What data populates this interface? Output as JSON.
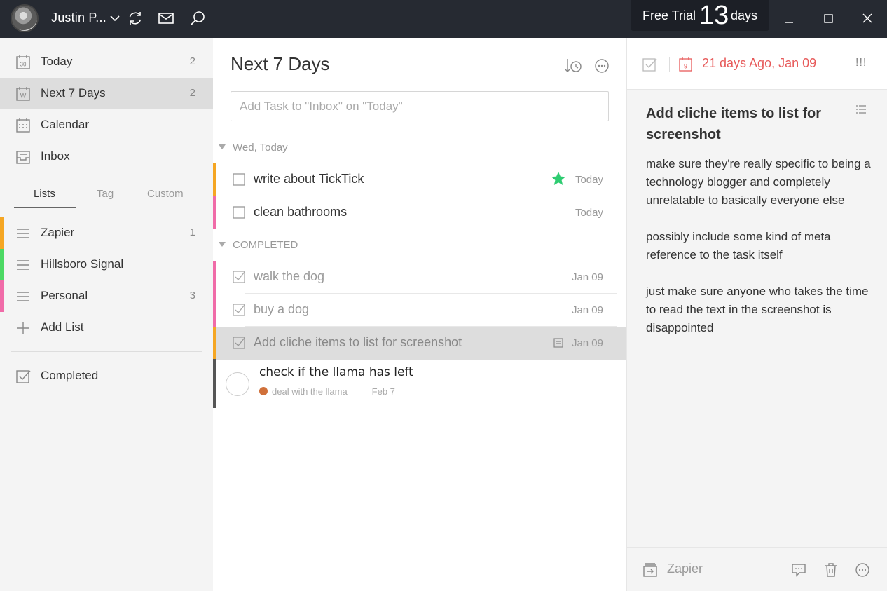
{
  "titlebar": {
    "user_name": "Justin P...",
    "trial_label": "Free Trial",
    "trial_days": "13",
    "trial_suffix": "days"
  },
  "sidebar": {
    "items": [
      {
        "label": "Today",
        "count": "2",
        "icon": "calendar-30-icon"
      },
      {
        "label": "Next 7 Days",
        "count": "2",
        "icon": "calendar-week-icon"
      },
      {
        "label": "Calendar",
        "count": "",
        "icon": "calendar-grid-icon"
      },
      {
        "label": "Inbox",
        "count": "",
        "icon": "inbox-icon"
      }
    ],
    "tabs": [
      "Lists",
      "Tag",
      "Custom"
    ],
    "lists": [
      {
        "label": "Zapier",
        "count": "1",
        "color": "#f5a623"
      },
      {
        "label": "Hillsboro Signal",
        "count": "",
        "color": "#4cd964"
      },
      {
        "label": "Personal",
        "count": "3",
        "color": "#f06ba8"
      }
    ],
    "add_list": "Add List",
    "completed": "Completed"
  },
  "main": {
    "title": "Next 7 Days",
    "add_placeholder": "Add Task to \"Inbox\" on \"Today\"",
    "section_today": "Wed, Today",
    "section_completed": "COMPLETED",
    "tasks": [
      {
        "title": "write about TickTick",
        "date": "Today",
        "color": "#f5a623",
        "starred": true
      },
      {
        "title": "clean bathrooms",
        "date": "Today",
        "color": "#f06ba8"
      }
    ],
    "completed": [
      {
        "title": "walk the dog",
        "date": "Jan 09",
        "color": "#f06ba8"
      },
      {
        "title": "buy a dog",
        "date": "Jan 09",
        "color": "#f06ba8"
      },
      {
        "title": "Add cliche items to list for screenshot",
        "date": "Jan 09",
        "color": "#f5a623"
      }
    ],
    "overlay_task": {
      "title": "check if the llama has left",
      "list": "deal with the llama",
      "date": "Feb 7"
    }
  },
  "detail": {
    "date_text": "21 days Ago, Jan 09",
    "date_day": "9",
    "priority": "!!!",
    "title": "Add cliche items to list for screenshot",
    "body": [
      "make sure they're really specific to being a technology blogger and completely unrelatable to basically everyone else",
      "possibly include some kind of meta reference to the task itself",
      "just make sure anyone who takes the time to read the text in the screenshot is disappointed"
    ],
    "list_name": "Zapier"
  },
  "colors": {
    "accent_red": "#e75a5a",
    "star_green": "#2ecc71",
    "titlebar": "#262a32"
  }
}
